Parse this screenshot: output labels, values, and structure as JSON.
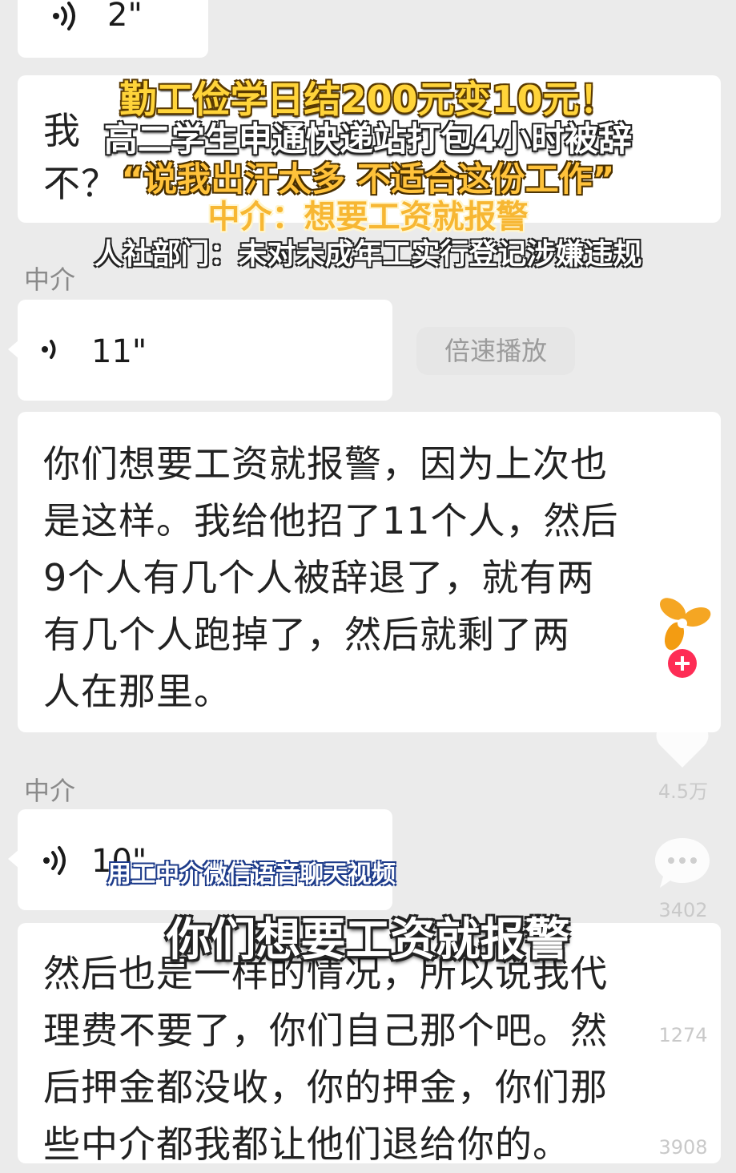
{
  "messages": {
    "voice_top_duration": "2\"",
    "obscured_bubble_text": [
      "我",
      "不？"
    ],
    "sender_1": "中介",
    "voice_mid_duration": "11\"",
    "speed_button": "倍速播放",
    "transcript_1": [
      "你们想要工资就报警，因为上次也",
      "是这样。我给他招了11个人，然后",
      "9个人有几个人被辞退了，就有两",
      "有几个人跑掉了，然后就剩了两",
      "人在那里。"
    ],
    "sender_2": "中介",
    "voice_bottom_duration": "10\"",
    "transcript_2": [
      "然后也是一样的情况，所以说我代",
      "理费不要了，你们自己那个吧。然",
      "后押金都没收，你的押金，你们那",
      "些中介都我都让他们退给你的。"
    ]
  },
  "overlay": {
    "headline_1": "勤工俭学日结200元变10元！",
    "headline_2": "高二学生申通快递站打包4小时被辞",
    "headline_3": "“说我出汗太多 不适合这份工作”",
    "headline_4": "中介：想要工资就报警",
    "headline_5": "人社部门：未对未成年工实行登记涉嫌违规",
    "caption_source": "用工中介微信语音聊天视频",
    "caption_main": "你们想要工资就报警"
  },
  "sidebar": {
    "like_count": "4.5万",
    "comment_count": "3402",
    "favorite_count": "1274",
    "share_count": "3908"
  },
  "colors": {
    "background": "#ebebeb",
    "bubble": "#ffffff",
    "headline_yellow": "#ffd43a",
    "avatar_orange": "#f5a623",
    "follow_red": "#fe2c55"
  }
}
